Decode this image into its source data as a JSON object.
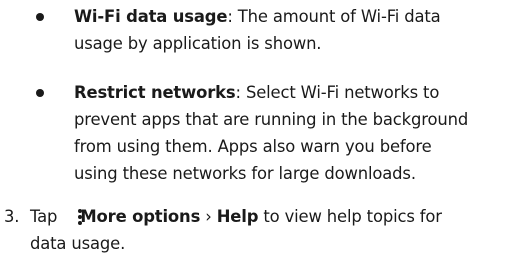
{
  "bullets": [
    {
      "term": "Wi-Fi data usage",
      "sep": ":",
      "lines": [
        " The amount of Wi-Fi data",
        "usage by application is shown."
      ]
    },
    {
      "term": "Restrict networks",
      "sep": ":",
      "lines": [
        " Select Wi-Fi networks to",
        "prevent apps that are running in the background",
        "from using them. Apps also warn you before",
        "using these networks for large downloads."
      ]
    }
  ],
  "step": {
    "number": "3.",
    "tap": "Tap",
    "more_options": "More options",
    "arrow": "›",
    "help": "Help",
    "rest": " to view help topics for",
    "line2": "data usage."
  },
  "icons": {
    "bullet": "filled-circle",
    "more_options": "vertical-ellipsis-icon"
  }
}
